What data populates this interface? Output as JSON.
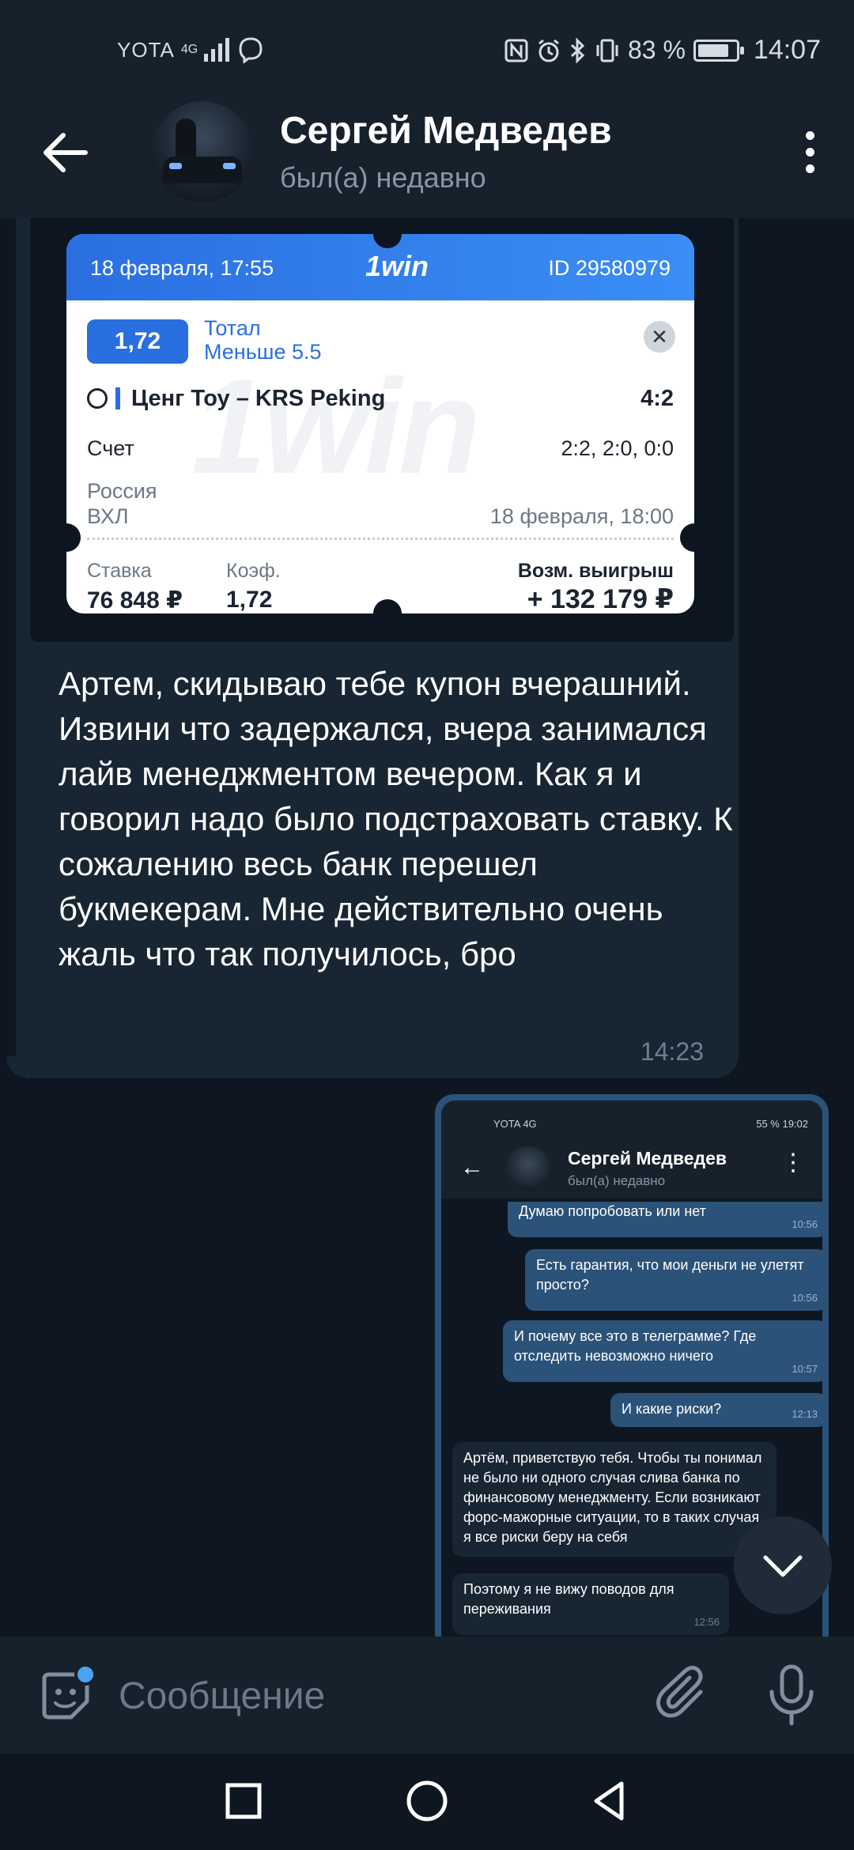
{
  "status_bar": {
    "carrier": "YOTA",
    "network": "4G",
    "battery_text": "83 %",
    "battery_level": 0.83,
    "time": "14:07"
  },
  "header": {
    "contact_name": "Сергей Медведев",
    "contact_status": "был(а) недавно"
  },
  "incoming_message": {
    "coupon": {
      "date": "18 февраля, 17:55",
      "brand": "1win",
      "id": "ID 29580979",
      "odds": "1,72",
      "bet_type_line1": "Тотал",
      "bet_type_line2": "Меньше 5.5",
      "match": "Ценг Тоу – KRS Peking",
      "match_score": "4:2",
      "score_label": "Счет",
      "period_scores": "2:2, 2:0, 0:0",
      "country": "Россия",
      "league": "ВХЛ",
      "match_time": "18 февраля, 18:00",
      "stake_label": "Ставка",
      "coef_label": "Коэф.",
      "payout_label": "Возм. выигрыш",
      "stake_value": "76 848 ₽",
      "coef_value": "1,72",
      "payout_value": "+ 132 179 ₽"
    },
    "text": "Артем, скидываю тебе купон вчерашний. Извини что задержался, вчера занимался лайв менеджментом вечером. Как я и говорил надо было подстраховать ставку. К сожалению весь банк перешел букмекерам. Мне действительно очень жаль что так получилось, бро",
    "time": "14:23"
  },
  "outgoing_screenshot": {
    "status_left": "YOTA 4G",
    "status_right": "55 % 19:02",
    "contact_name": "Сергей Медведев",
    "contact_status": "был(а) недавно",
    "messages": [
      {
        "direction": "out",
        "text": "Думаю попробовать или нет",
        "time": "10:56"
      },
      {
        "direction": "out",
        "text": "Есть гарантия, что мои деньги не улетят просто?",
        "time": "10:56"
      },
      {
        "direction": "out",
        "text": "И почему все это в телеграмме? Где отследить невозможно ничего",
        "time": "10:57"
      },
      {
        "direction": "out",
        "text": "И какие риски?",
        "time": "12:13"
      },
      {
        "direction": "in",
        "text": "Артём, приветствую тебя. Чтобы ты понимал не было ни одного случая слива банка по финансовому менеджменту. Если возникают форс-мажорные ситуации, то в таких случая я все риски беру на себя",
        "time": ""
      },
      {
        "direction": "in",
        "text": "Поэтому я не вижу поводов для переживания",
        "time": "12:56"
      }
    ]
  },
  "input": {
    "placeholder": "Сообщение"
  },
  "colors": {
    "background": "#0e1621",
    "header": "#17212b",
    "incoming_bubble": "#182533",
    "outgoing_bubble": "#2b5278",
    "accent": "#4aa3f0",
    "coupon_blue": "#2a6fe0"
  },
  "icons": [
    "back-arrow-icon",
    "menu-dots-icon",
    "chevron-down-icon",
    "sticker-icon",
    "paperclip-icon",
    "microphone-icon",
    "nav-recents-icon",
    "nav-home-icon",
    "nav-back-icon"
  ]
}
